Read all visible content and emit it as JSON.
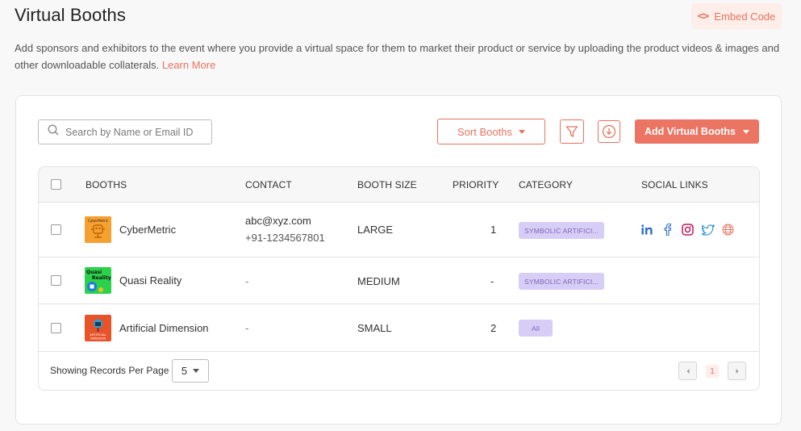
{
  "header": {
    "title": "Virtual Booths",
    "embed_label": "Embed Code",
    "embed_icon": "code-icon",
    "description": "Add sponsors and exhibitors to the event where you provide a virtual space for them to market their product or service by uploading the product videos & images and other downloadable collaterals.",
    "learn_more": "Learn More"
  },
  "toolbar": {
    "search_placeholder": "Search by Name or Email ID",
    "sort_label": "Sort Booths",
    "add_label": "Add Virtual Booths",
    "filter_icon": "filter-icon",
    "download_icon": "download-icon"
  },
  "table": {
    "columns": [
      "BOOTHS",
      "CONTACT",
      "BOOTH SIZE",
      "PRIORITY",
      "CATEGORY",
      "SOCIAL LINKS"
    ],
    "rows": [
      {
        "name": "CyberMetric",
        "email": "abc@xyz.com",
        "phone": "+91-1234567801",
        "size": "LARGE",
        "priority": "1",
        "category": "SYMBOLIC ARTIFICI...",
        "logo_text": "CyberMetric",
        "social": [
          "linkedin-icon",
          "facebook-icon",
          "instagram-icon",
          "twitter-icon",
          "globe-icon"
        ]
      },
      {
        "name": "Quasi Reality",
        "contact": "-",
        "size": "MEDIUM",
        "priority": "-",
        "category": "SYMBOLIC ARTIFICI...",
        "logo_text_1": "Quasi",
        "logo_text_2": "Reality"
      },
      {
        "name": "Artificial Dimension",
        "contact": "-",
        "size": "SMALL",
        "priority": "2",
        "category": "All",
        "logo_text_1": "ARTIFICIAL",
        "logo_text_2": "DIMENSION"
      }
    ]
  },
  "footer": {
    "records_label": "Showing Records Per Page",
    "per_page": "5",
    "current_page": "1"
  },
  "colors": {
    "accent": "#ec7463",
    "badge_bg": "#d8cdf7",
    "social_blue": "#2a6dd1",
    "social_insta": "#c2185b"
  }
}
